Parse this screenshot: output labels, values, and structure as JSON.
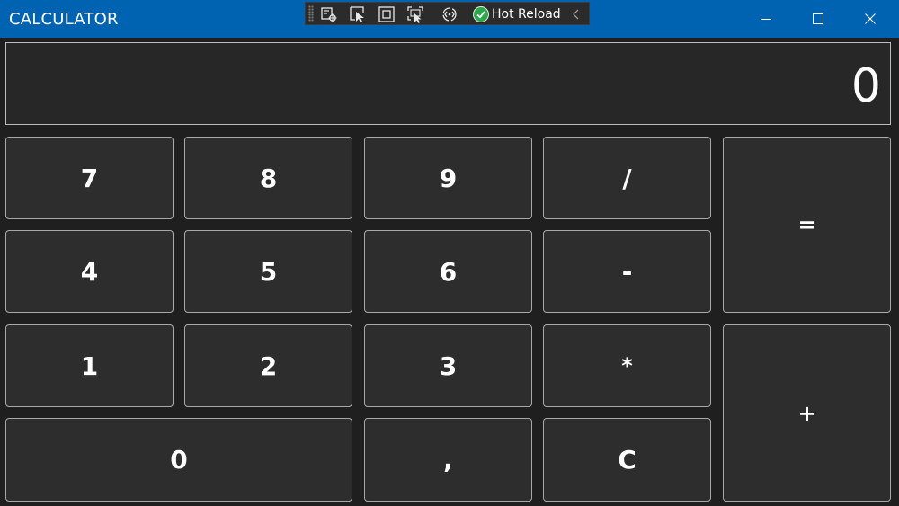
{
  "window": {
    "title": "CALCULATOR",
    "accent_color": "#0063b1",
    "background_color": "#1f1f1f"
  },
  "devbar": {
    "tools": [
      {
        "icon": "live-visual-tree-icon"
      },
      {
        "icon": "select-element-icon"
      },
      {
        "icon": "display-layout-adorners-icon"
      },
      {
        "icon": "track-focus-icon"
      },
      {
        "icon": "xaml-binding-icon"
      }
    ],
    "hot_reload_label": "Hot Reload",
    "hot_reload_status_color": "#2aa84a"
  },
  "caption_buttons": {
    "minimize": "minimize-icon",
    "maximize": "maximize-icon",
    "close": "close-icon"
  },
  "display": {
    "value": "0"
  },
  "keys": {
    "seven": "7",
    "eight": "8",
    "nine": "9",
    "divide": "/",
    "equals": "=",
    "four": "4",
    "five": "5",
    "six": "6",
    "minus": "-",
    "one": "1",
    "two": "2",
    "three": "3",
    "multiply": "*",
    "plus": "+",
    "zero": "0",
    "comma": ",",
    "clear": "C"
  }
}
